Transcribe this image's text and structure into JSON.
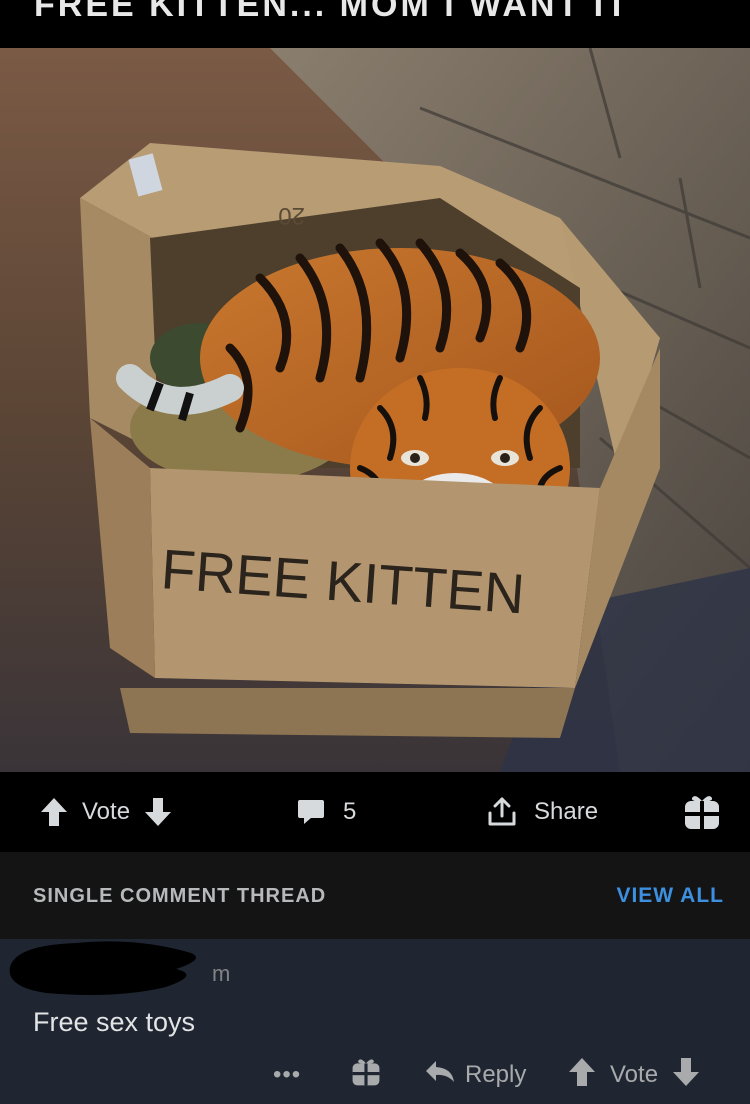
{
  "post": {
    "title_fragment": "FREE KITTEN... MOM I WANT IT",
    "image_caption_text": "FREE KITTEN",
    "image_box_mark": "20"
  },
  "action_bar": {
    "vote_label": "Vote",
    "comment_count": "5",
    "share_label": "Share"
  },
  "thread": {
    "title": "SINGLE COMMENT THREAD",
    "view_all": "VIEW ALL"
  },
  "comment": {
    "username_visible_tail": "m",
    "body": "Free sex toys",
    "more_label": "•••",
    "reply_label": "Reply",
    "vote_label": "Vote"
  },
  "colors": {
    "accent_link": "#3d8fe0",
    "comment_bg": "#1f2632",
    "header_bg": "#141414"
  }
}
